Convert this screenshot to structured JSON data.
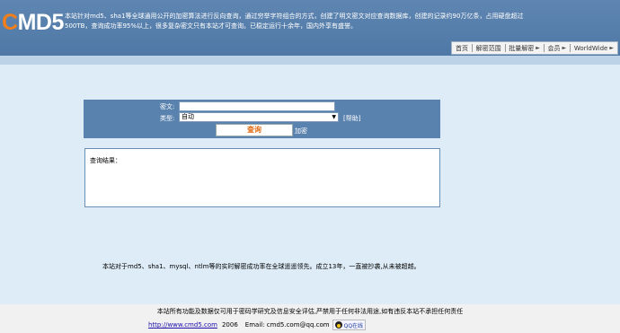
{
  "logo": {
    "first_letter": "C",
    "rest": "MD5"
  },
  "intro": "本站针对md5、sha1等全球通用公开的加密算法进行反向查询，通过穷举字符组合的方式，创建了明文密文对应查询数据库，创建的记录约90万亿条，占用硬盘超过500TB，查询成功率95%以上，很多复杂密文只有本站才可查询。已稳定运行十余年，国内外享有盛誉。",
  "nav": {
    "items": [
      {
        "label": "首页",
        "dropdown": false
      },
      {
        "label": "解密范围",
        "dropdown": false
      },
      {
        "label": "批量解密",
        "dropdown": true
      },
      {
        "label": "会员",
        "dropdown": true
      },
      {
        "label": "WorldWide",
        "dropdown": true
      }
    ]
  },
  "form": {
    "cipher_label": "密文:",
    "cipher_value": "",
    "type_label": "类型:",
    "type_selected": "自动",
    "help_label": "[帮助]",
    "query_button": "查询",
    "encrypt_link": "加密"
  },
  "result": {
    "label": "查询结果："
  },
  "info": "本站对于md5、sha1、mysql、ntlm等的实时解密成功率在全球遥遥领先。成立13年，一直被抄袭,从未被超越。",
  "footer": {
    "disclaimer": "本站所有功能及数据仅可用于密码学研究及信息安全评估,严禁用于任何非法用途,如有违反本站不承担任何责任",
    "link": "http://www.cmd5.com",
    "year": "2006",
    "email": "Email: cmd5.com@qq.com",
    "qq_label": "QQ在线"
  },
  "colors": {
    "header": "#567ea9",
    "page_bg": "#ddecf6",
    "panel": "#5a82ae",
    "accent": "#f07e1a"
  }
}
